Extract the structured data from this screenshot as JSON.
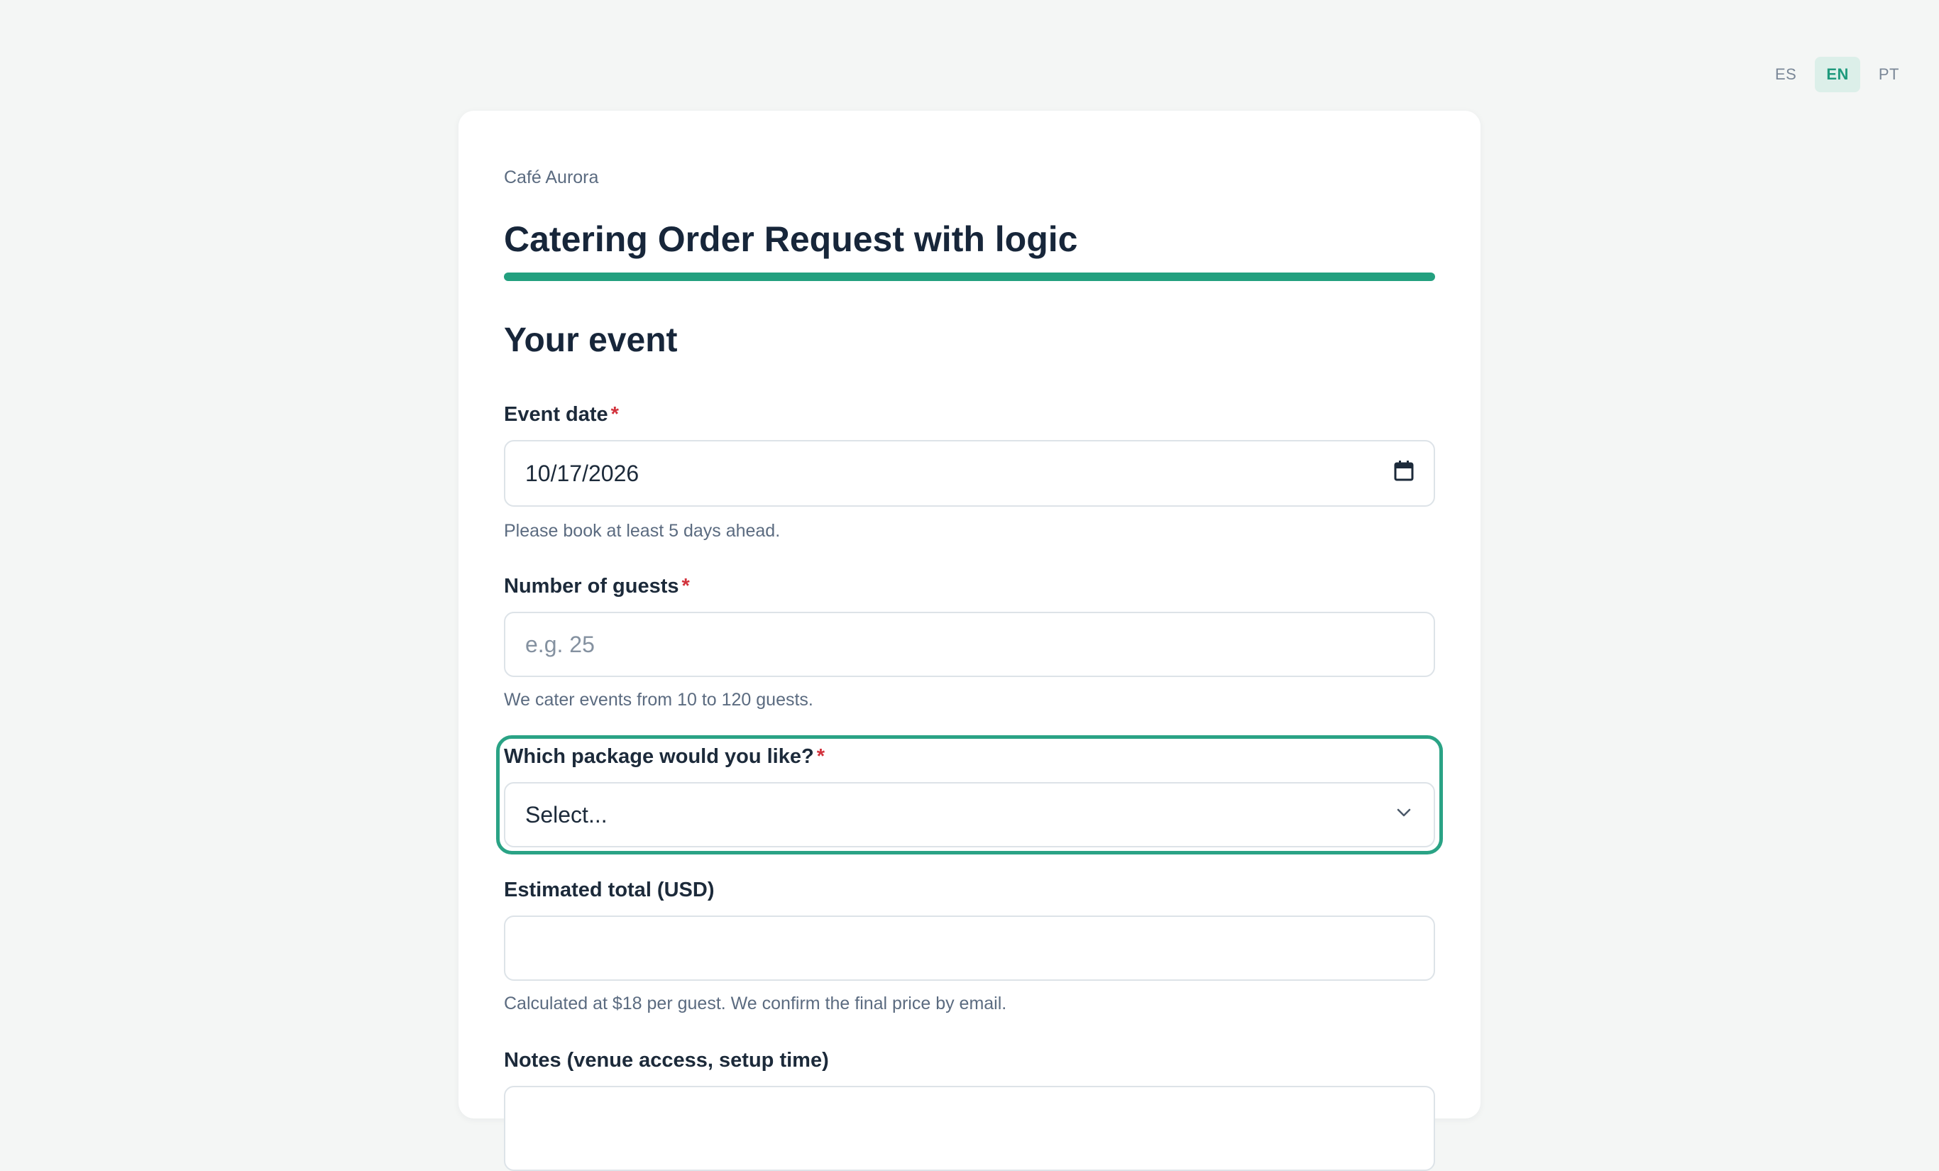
{
  "languages": [
    {
      "code": "ES",
      "active": false
    },
    {
      "code": "EN",
      "active": true
    },
    {
      "code": "PT",
      "active": false
    }
  ],
  "form": {
    "brand": "Café Aurora",
    "title": "Catering Order Request with logic",
    "progress_fraction": 1.0,
    "section_title": "Your event",
    "required_marker": "*",
    "fields": {
      "event_date": {
        "label": "Event date",
        "value": "10/17/2026",
        "hint": "Please book at least 5 days ahead."
      },
      "guests": {
        "label": "Number of guests",
        "placeholder": "e.g. 25",
        "hint": "We cater events from 10 to 120 guests."
      },
      "package": {
        "label": "Which package would you like?",
        "selected": "Select..."
      },
      "estimated_total": {
        "label": "Estimated total (USD)",
        "value": "",
        "hint": "Calculated at $18 per guest. We confirm the final price by email."
      },
      "notes": {
        "label": "Notes (venue access, setup time)"
      }
    }
  },
  "colors": {
    "accent": "#23a07f",
    "required": "#d2323c",
    "background": "#f4f6f5"
  },
  "icons": {
    "date_field": "calendar-icon",
    "select_field": "chevron-down-icon"
  }
}
